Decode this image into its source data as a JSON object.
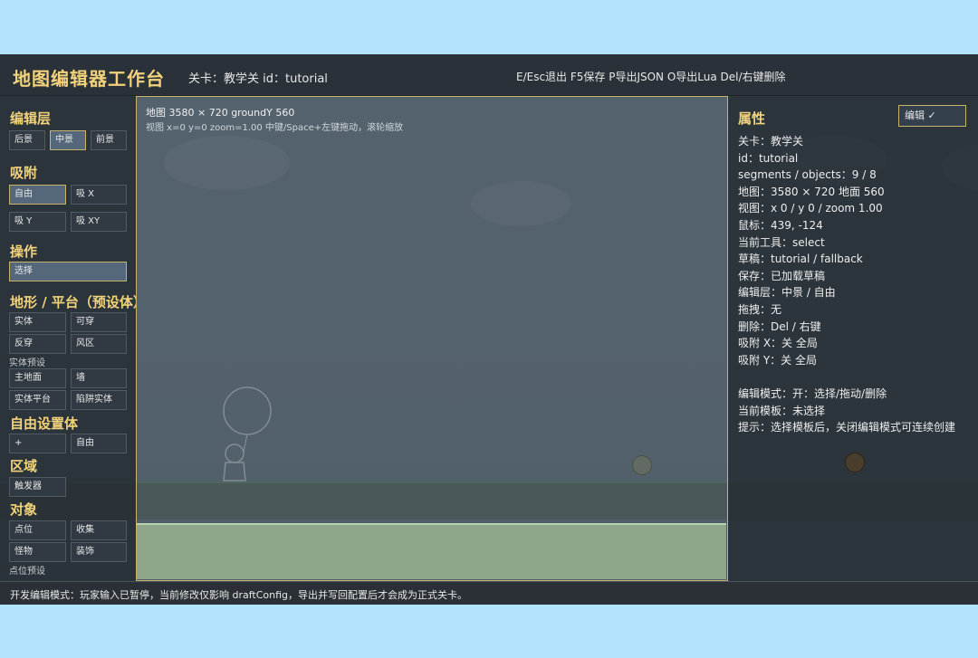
{
  "header": {
    "title": "地图编辑器工作台",
    "level_info": "关卡：教学关  id：tutorial",
    "hotkeys": "E/Esc退出 F5保存 P导出JSON O导出Lua Del/右键删除"
  },
  "left_panel": {
    "layer": {
      "title": "编辑层",
      "buttons": [
        "后景",
        "中景",
        "前景"
      ],
      "active": "中景"
    },
    "snap": {
      "title": "吸附",
      "buttons": [
        "自由",
        "吸 X",
        "吸 Y",
        "吸 XY"
      ],
      "active": "自由"
    },
    "action": {
      "title": "操作",
      "buttons": [
        "选择"
      ],
      "active": "选择"
    },
    "terrain": {
      "title": "地形 / 平台（预设体）",
      "buttons": [
        "实体",
        "可穿",
        "反穿",
        "风区"
      ],
      "preset_label": "实体预设",
      "preset_buttons": [
        "主地面",
        "墙",
        "实体平台",
        "陷阱实体"
      ]
    },
    "free": {
      "title": "自由设置体",
      "buttons": [
        "+",
        "自由"
      ]
    },
    "zone": {
      "title": "区域",
      "buttons": [
        "触发器"
      ]
    },
    "objects": {
      "title": "对象",
      "buttons": [
        "点位",
        "收集",
        "怪物",
        "装饰"
      ],
      "preset_label": "点位预设"
    }
  },
  "canvas": {
    "info_line1": "地图 3580 × 720  groundY 560",
    "info_line2": "视图 x=0 y=0 zoom=1.00  中键/Space+左键拖动，滚轮缩放"
  },
  "properties": {
    "title": "属性",
    "edit_toggle": "编辑 ✓",
    "lines": [
      "关卡：教学关",
      "id：tutorial",
      "segments / objects：9 / 8",
      "地图：3580 × 720  地面 560",
      "视图：x 0 / y 0 / zoom 1.00",
      "鼠标：439, -124",
      "当前工具：select",
      "草稿：tutorial / fallback",
      "保存：已加载草稿",
      "编辑层：中景 / 自由",
      "拖拽：无",
      "删除：Del / 右键",
      "吸附 X：关 全局",
      "吸附 Y：关 全局",
      "",
      "编辑模式：开：选择/拖动/删除",
      "当前模板：未选择",
      "提示：选择模板后，关闭编辑模式可连续创建"
    ]
  },
  "status": {
    "text": "开发编辑模式：玩家输入已暂停，当前修改仅影响 draftConfig，导出并写回配置后才会成为正式关卡。"
  },
  "colors": {
    "accent": "#f2d27a",
    "active_button_border": "#c9b36a",
    "ground": "#8ea58a"
  }
}
